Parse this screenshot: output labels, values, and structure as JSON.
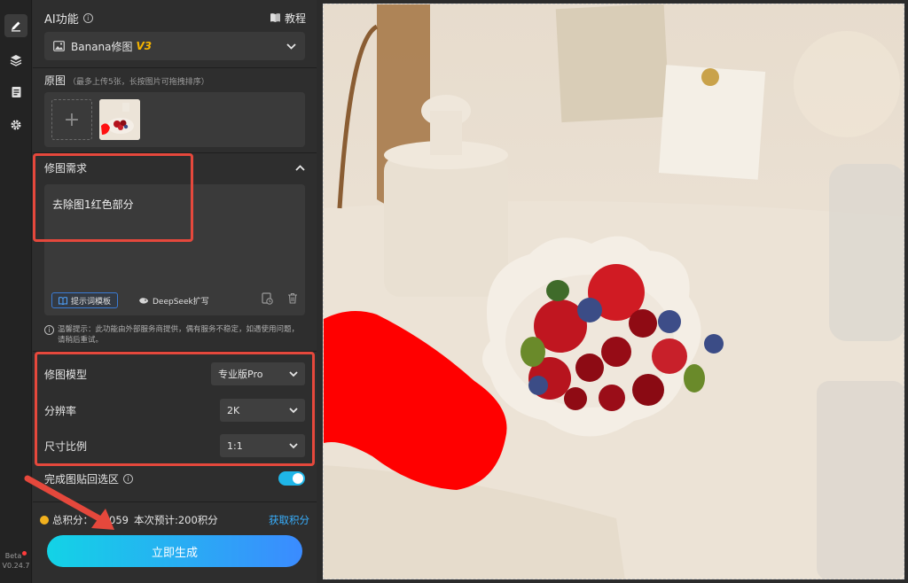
{
  "rail": {
    "icons": [
      "pencil-icon",
      "layers-icon",
      "document-icon",
      "gear-icon"
    ],
    "beta_label": "Beta",
    "version": "V0.24.7"
  },
  "panel": {
    "ai_title": "AI功能",
    "tutorial": "教程",
    "model_name": "Banana修图",
    "model_version": "V3"
  },
  "original": {
    "title": "原图",
    "hint": "（最多上传5张，长按图片可拖拽排序）",
    "add_symbol": "+"
  },
  "request": {
    "title": "修图需求",
    "text": "去除图1红色部分",
    "template_button": "提示词模板",
    "deepseek_button": "DeepSeek扩写"
  },
  "notice": "温馨提示：此功能由外部服务商提供，偶有服务不稳定，如遇使用问题，请稍后重试。",
  "params": {
    "model_label": "修图模型",
    "model_value": "专业版Pro",
    "resolution_label": "分辨率",
    "resolution_value": "2K",
    "ratio_label": "尺寸比例",
    "ratio_value": "1:1"
  },
  "toggle": {
    "label": "完成图贴回选区",
    "on": true
  },
  "points": {
    "total": "总积分：",
    "total_value": "059",
    "estimate": "本次预计:200积分",
    "get": "获取积分"
  },
  "generate_button": "立即生成",
  "colors": {
    "accent": "#1fb6e8",
    "highlight_box": "#e5483c",
    "mask": "#ff0000",
    "link": "#38b0ff",
    "version_badge": "#f5b400"
  }
}
